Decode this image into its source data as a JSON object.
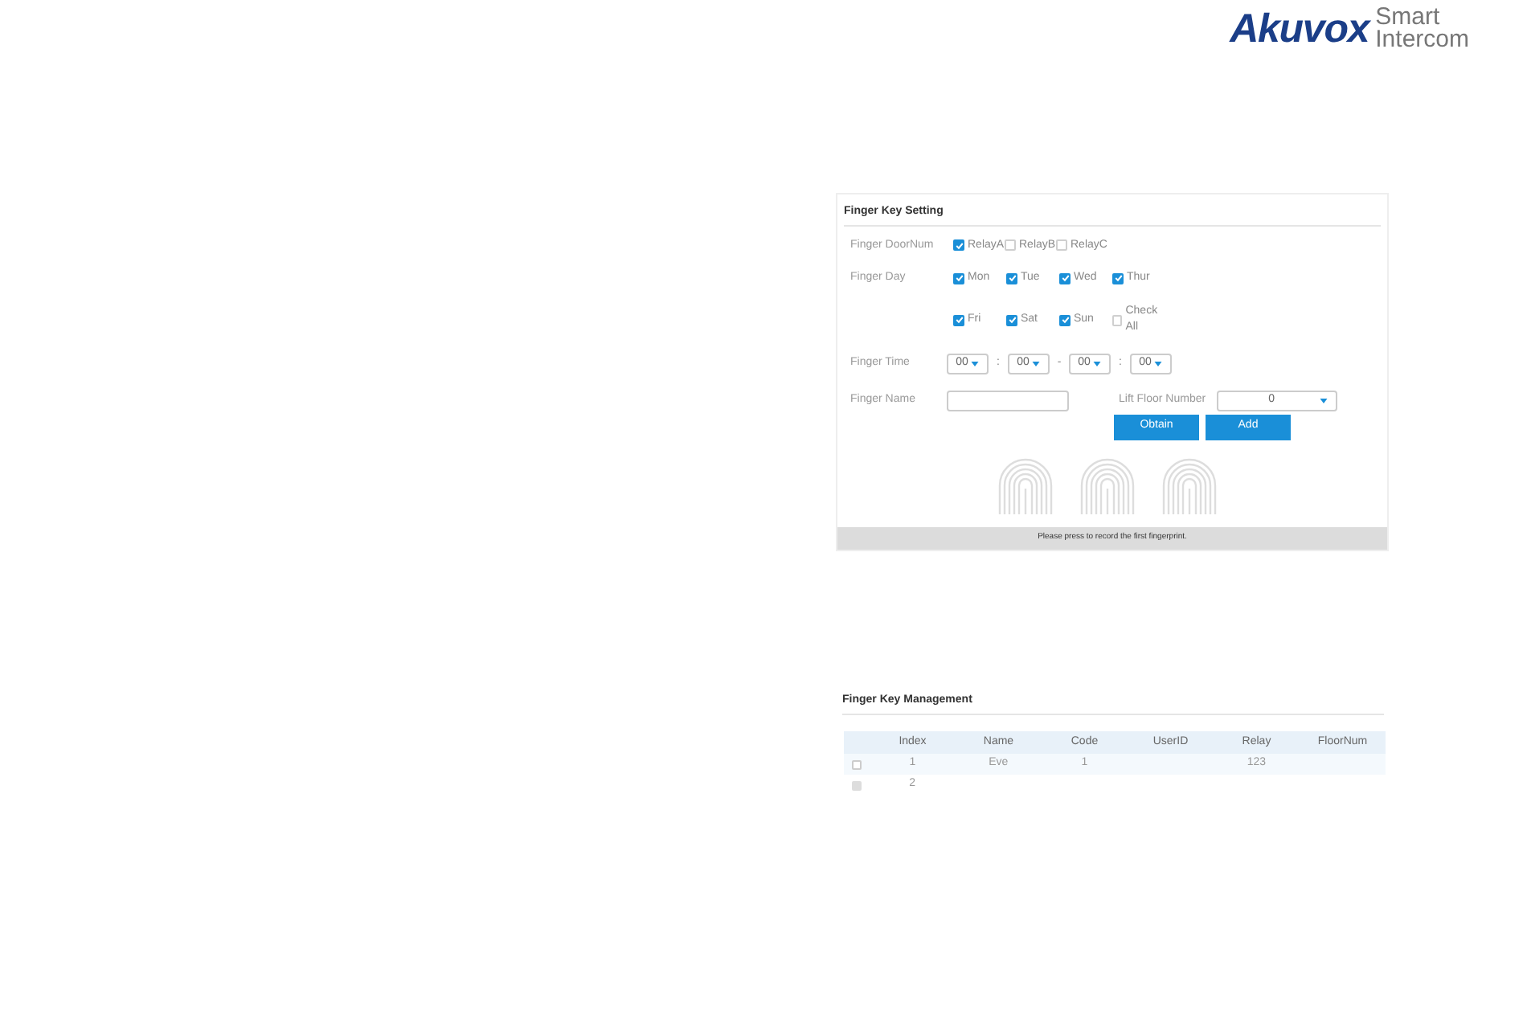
{
  "logo": {
    "brand": "Akuvox",
    "tagline_1": "Smart",
    "tagline_2": "Intercom"
  },
  "setting": {
    "title": "Finger Key Setting",
    "door_label": "Finger DoorNum",
    "relays": [
      {
        "label": "RelayA",
        "checked": true
      },
      {
        "label": "RelayB",
        "checked": false
      },
      {
        "label": "RelayC",
        "checked": false
      }
    ],
    "day_label": "Finger Day",
    "days": [
      {
        "label": "Mon",
        "checked": true
      },
      {
        "label": "Tue",
        "checked": true
      },
      {
        "label": "Wed",
        "checked": true
      },
      {
        "label": "Thur",
        "checked": true
      },
      {
        "label": "Fri",
        "checked": true
      },
      {
        "label": "Sat",
        "checked": true
      },
      {
        "label": "Sun",
        "checked": true
      },
      {
        "label": "Check All",
        "checked": false
      }
    ],
    "time_label": "Finger Time",
    "times": [
      {
        "value": "00",
        "separator": ":"
      },
      {
        "value": "00",
        "separator": "-"
      },
      {
        "value": "00",
        "separator": ":"
      },
      {
        "value": "00"
      }
    ],
    "name_label": "Finger Name",
    "floor_label": "Lift Floor Number",
    "floor_value": "0",
    "buttons": [
      "Obtain",
      "Add"
    ],
    "status": "Please press to record the first fingerprint."
  },
  "management": {
    "title": "Finger Key Management",
    "columns": [
      "Index",
      "Name",
      "Code",
      "UserID",
      "Relay",
      "FloorNum"
    ],
    "rows": [
      {
        "disabled": false,
        "cells": [
          "1",
          "Eve",
          "1",
          "",
          "123",
          ""
        ]
      },
      {
        "disabled": true,
        "cells": [
          "2",
          "",
          "",
          "",
          "",
          ""
        ]
      }
    ]
  }
}
